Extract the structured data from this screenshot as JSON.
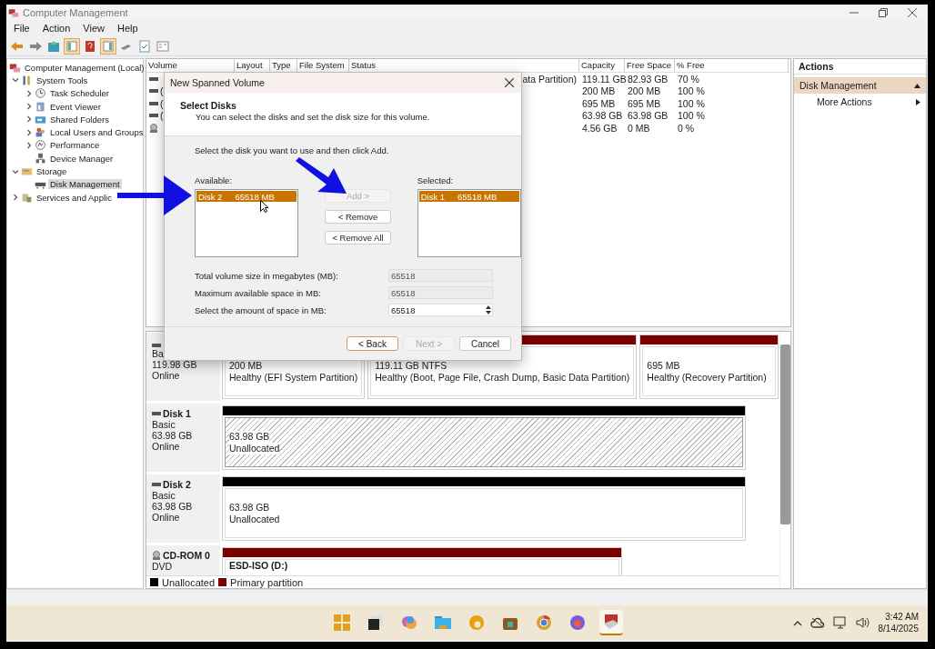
{
  "window": {
    "title": "Computer Management"
  },
  "menu": [
    "File",
    "Action",
    "View",
    "Help"
  ],
  "tree": [
    {
      "label": "Computer Management (Local)",
      "kind": "computer",
      "selected": false,
      "children": [
        {
          "label": "System Tools",
          "kind": "tools",
          "expanded": true,
          "selected": false,
          "children": [
            {
              "label": "Task Scheduler",
              "kind": "clock",
              "expanded": false,
              "selected": false
            },
            {
              "label": "Event Viewer",
              "kind": "log",
              "expanded": false,
              "selected": false
            },
            {
              "label": "Shared Folders",
              "kind": "share",
              "expanded": false,
              "selected": false
            },
            {
              "label": "Local Users and Groups",
              "kind": "users",
              "expanded": false,
              "selected": false
            },
            {
              "label": "Performance",
              "kind": "perf",
              "expanded": false,
              "selected": false
            },
            {
              "label": "Device Manager",
              "kind": "device",
              "selected": false
            }
          ]
        },
        {
          "label": "Storage",
          "kind": "storage",
          "expanded": true,
          "selected": false,
          "children": [
            {
              "label": "Disk Management",
              "kind": "disk",
              "selected": true
            }
          ]
        },
        {
          "label": "Services and Applic",
          "kind": "services",
          "expanded": false,
          "selected": false
        }
      ]
    }
  ],
  "table": {
    "columns": [
      "Volume",
      "Layout",
      "Type",
      "File System",
      "Status",
      "Capacity",
      "Free Space",
      "% Free"
    ],
    "rows": [
      {
        "kind": "disk",
        "status": "ata Partition)",
        "capacity": "119.11 GB",
        "free_space": "82.93 GB",
        "percent_free": "70 %"
      },
      {
        "kind": "disk",
        "volume": "(",
        "capacity": "200 MB",
        "free_space": "200 MB",
        "percent_free": "100 %"
      },
      {
        "kind": "disk",
        "volume": "(",
        "capacity": "695 MB",
        "free_space": "695 MB",
        "percent_free": "100 %"
      },
      {
        "kind": "disk",
        "volume": "(",
        "capacity": "63.98 GB",
        "free_space": "63.98 GB",
        "percent_free": "100 %"
      },
      {
        "kind": "cdrom",
        "capacity": "4.56 GB",
        "free_space": "0 MB",
        "percent_free": "0 %"
      }
    ]
  },
  "disks": [
    {
      "kind": "disk",
      "type": "Ba",
      "size": "119.98 GB",
      "status": "Online",
      "partitions": [
        {
          "selected": false,
          "size": "200 MB",
          "status": "Healthy (EFI System Partition)"
        },
        {
          "kind": "primary",
          "selected": false,
          "size": "119.11 GB NTFS",
          "status": "Healthy (Boot, Page File, Crash Dump, Basic Data Partition)"
        },
        {
          "kind": "primary",
          "selected": false,
          "size": "695 MB",
          "status": "Healthy (Recovery Partition)"
        }
      ]
    },
    {
      "kind": "disk",
      "name": "Disk 1",
      "type": "Basic",
      "size": "63.98 GB",
      "status": "Online",
      "partitions": [
        {
          "kind": "unallocated",
          "selected": true,
          "size": "63.98 GB",
          "status": "Unallocated"
        }
      ]
    },
    {
      "kind": "disk",
      "name": "Disk 2",
      "type": "Basic",
      "size": "63.98 GB",
      "status": "Online",
      "partitions": [
        {
          "kind": "unallocated",
          "selected": false,
          "size": "63.98 GB",
          "status": "Unallocated"
        }
      ]
    },
    {
      "kind": "cdrom",
      "name": "CD-ROM 0",
      "type": "DVD",
      "partitions": [
        {
          "kind": "primary",
          "selected": false,
          "label": "ESD-ISO  (D:)"
        }
      ]
    }
  ],
  "legend": [
    {
      "label": "Unallocated",
      "color": "#000000"
    },
    {
      "label": "Primary partition",
      "color": "#7b0000"
    }
  ],
  "actions": {
    "title": "Actions",
    "section": "Disk Management",
    "items": [
      "More Actions"
    ]
  },
  "dialog": {
    "title": "New Spanned Volume",
    "heading": "Select Disks",
    "subheading": "You can select the disks and set the disk size for this volume.",
    "instruction": "Select the disk you want to use and then click Add.",
    "available": {
      "label": "Available:",
      "items": [
        {
          "disk": "Disk 2",
          "size": "65518 MB",
          "selected": true
        }
      ]
    },
    "selected": {
      "label": "Selected:",
      "items": [
        {
          "disk": "Disk 1",
          "size": "65518 MB",
          "selected": true
        }
      ]
    },
    "move_buttons": [
      {
        "label": "Add >",
        "disabled": true
      },
      {
        "label": "< Remove",
        "disabled": false
      },
      {
        "label": "< Remove All",
        "disabled": false
      }
    ],
    "fields": [
      {
        "label": "Total volume size in megabytes (MB):",
        "value": "65518",
        "kind": "readonly"
      },
      {
        "label": "Maximum available space in MB:",
        "value": "65518",
        "kind": "readonly"
      },
      {
        "label": "Select the amount of space in MB:",
        "value": "65518",
        "kind": "spinner"
      }
    ],
    "buttons": [
      {
        "label": "< Back",
        "disabled": false,
        "default": true
      },
      {
        "label": "Next >",
        "disabled": true,
        "default": false
      },
      {
        "label": "Cancel",
        "disabled": false,
        "default": false
      }
    ]
  },
  "taskbar": {
    "time": "3:42 AM",
    "date": "8/14/2025"
  }
}
